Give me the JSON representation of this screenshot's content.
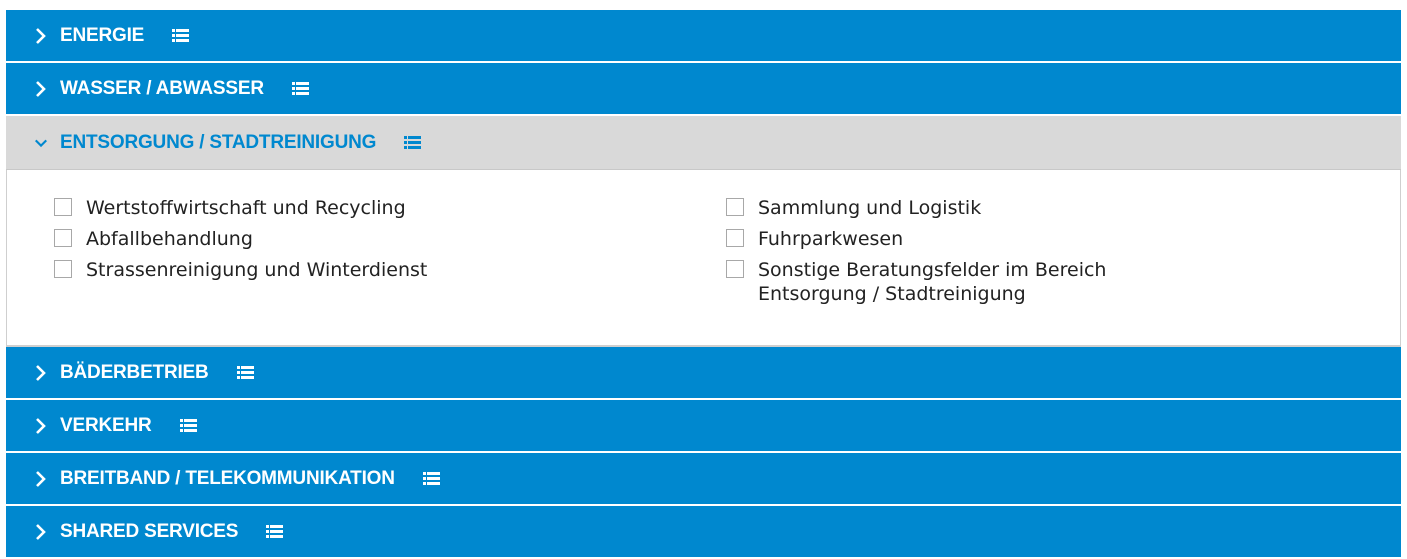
{
  "colors": {
    "header_bg": "#0088cf",
    "open_header_bg": "#d9d9d9",
    "open_title": "#0088cf"
  },
  "sections": [
    {
      "title": "ENERGIE",
      "expanded": false,
      "icon": "chevron-right-icon"
    },
    {
      "title": "WASSER / ABWASSER",
      "expanded": false,
      "icon": "chevron-right-icon"
    },
    {
      "title": "ENTSORGUNG / STADTREINIGUNG",
      "expanded": true,
      "icon": "chevron-down-icon",
      "options_left": [
        "Wertstoffwirtschaft und Recycling",
        "Abfallbehandlung",
        "Strassenreinigung und Winterdienst"
      ],
      "options_right": [
        "Sammlung und Logistik",
        "Fuhrparkwesen",
        "Sonstige Beratungsfelder im Bereich Entsorgung / Stadtreinigung"
      ]
    },
    {
      "title": "BÄDERBETRIEB",
      "expanded": false,
      "icon": "chevron-right-icon"
    },
    {
      "title": "VERKEHR",
      "expanded": false,
      "icon": "chevron-right-icon"
    },
    {
      "title": "BREITBAND / TELEKOMMUNIKATION",
      "expanded": false,
      "icon": "chevron-right-icon"
    },
    {
      "title": "SHARED SERVICES",
      "expanded": false,
      "icon": "chevron-right-icon"
    }
  ]
}
